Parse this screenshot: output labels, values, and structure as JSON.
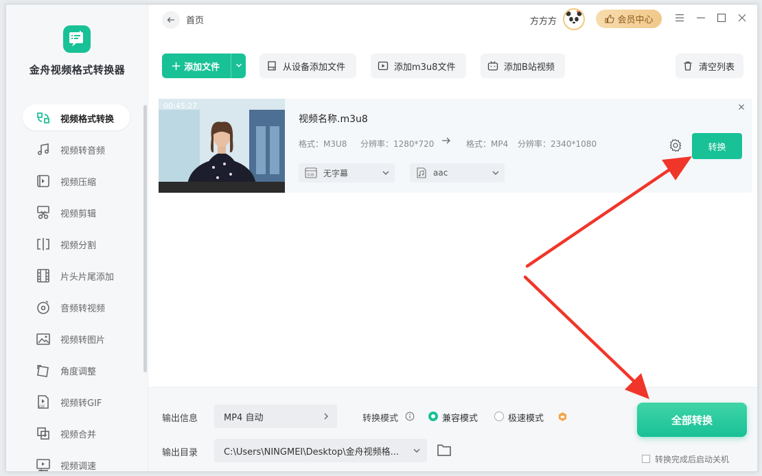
{
  "app": {
    "name": "金舟视频格式转换器",
    "accent": "#19C196"
  },
  "sidebar": {
    "items": [
      {
        "label": "视频格式转换",
        "icon": "format-convert-icon",
        "active": true
      },
      {
        "label": "视频转音频",
        "icon": "music-note-icon"
      },
      {
        "label": "视频压缩",
        "icon": "compress-icon"
      },
      {
        "label": "视频剪辑",
        "icon": "scissors-icon"
      },
      {
        "label": "视频分割",
        "icon": "split-icon"
      },
      {
        "label": "片头片尾添加",
        "icon": "film-strip-icon"
      },
      {
        "label": "音频转视频",
        "icon": "audio-disc-icon"
      },
      {
        "label": "视频转图片",
        "icon": "image-icon"
      },
      {
        "label": "角度调整",
        "icon": "rotate-icon"
      },
      {
        "label": "视频转GIF",
        "icon": "gif-file-icon"
      },
      {
        "label": "视频合并",
        "icon": "merge-icon"
      },
      {
        "label": "视频调速",
        "icon": "speed-icon"
      }
    ]
  },
  "topbar": {
    "breadcrumb": "首页",
    "username": "方方方",
    "vip_label": "会员中心"
  },
  "toolbar": {
    "add_file": "添加文件",
    "add_from_device": "从设备添加文件",
    "add_m3u8": "添加m3u8文件",
    "add_bilibili": "添加B站视频",
    "clear_list": "清空列表"
  },
  "file": {
    "duration": "00:45:27",
    "name": "视频名称.m3u8",
    "src_format": "格式：M3U8",
    "src_resolution": "分辨率：1280*720",
    "dst_format": "格式：MP4",
    "dst_resolution": "分辨率：2340*1080",
    "subtitle": "无字幕",
    "audio": "aac",
    "convert_label": "转换"
  },
  "bottom": {
    "output_info_label": "输出信息",
    "output_info_value": "MP4 自动",
    "mode_label": "转换模式",
    "mode_options": [
      "兼容模式",
      "极速模式"
    ],
    "mode_selected": "兼容模式",
    "output_dir_label": "输出目录",
    "output_dir_value": "C:\\Users\\NINGMEI\\Desktop\\金舟视频格...",
    "convert_all": "全部转换",
    "auto_shutdown": "转换完成后启动关机"
  }
}
